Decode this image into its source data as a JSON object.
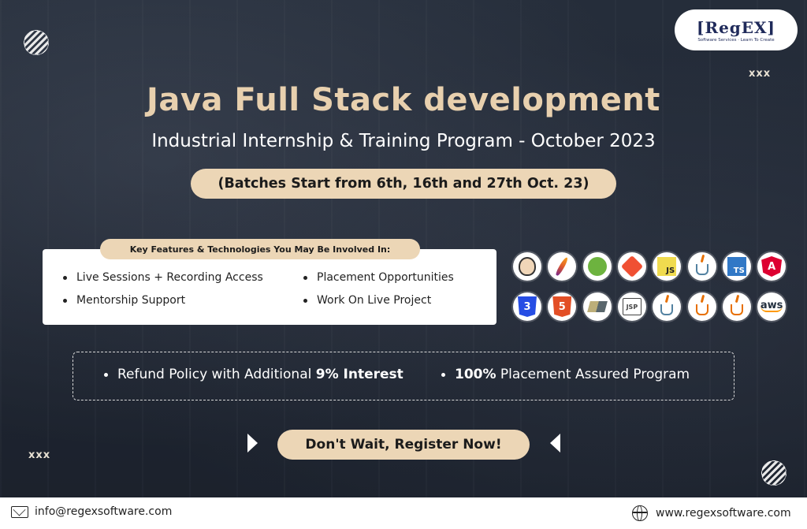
{
  "logo": {
    "text": "[RegEX]",
    "tagline": "Software Services · Learn To Create"
  },
  "decorations": {
    "xmark_top": "xxx",
    "xmark_bottom": "xxx"
  },
  "title": "Java Full Stack development",
  "subtitle": "Industrial Internship & Training Program - October 2023",
  "batches": "(Batches Start from 6th, 16th and 27th Oct. 23)",
  "features": {
    "heading": "Key Features & Technologies You May Be Involved In:",
    "items": [
      "Live Sessions + Recording Access",
      "Placement Opportunities",
      "Mentorship  Support",
      "Work On Live Project"
    ]
  },
  "technologies": [
    {
      "name": "jenkins-icon",
      "label": "",
      "color": "#d33833"
    },
    {
      "name": "maven-feather-icon",
      "label": "",
      "color": "#e05a2b"
    },
    {
      "name": "spring-icon",
      "label": "",
      "color": "#6db33f"
    },
    {
      "name": "git-icon",
      "label": "",
      "color": "#f05033"
    },
    {
      "name": "javascript-icon",
      "label": "JS",
      "color": "#f0db4f"
    },
    {
      "name": "java-icon",
      "label": "",
      "color": "#5382a1"
    },
    {
      "name": "typescript-icon",
      "label": "TS",
      "color": "#3178c6"
    },
    {
      "name": "angular-icon",
      "label": "A",
      "color": "#dd0031"
    },
    {
      "name": "css3-icon",
      "label": "3",
      "color": "#264de4"
    },
    {
      "name": "html5-icon",
      "label": "5",
      "color": "#e34f26"
    },
    {
      "name": "hibernate-icon",
      "label": "",
      "color": "#59666c"
    },
    {
      "name": "jsp-icon",
      "label": "JSP",
      "color": "#444444"
    },
    {
      "name": "java-ee-icon",
      "label": "",
      "color": "#5382a1"
    },
    {
      "name": "java-se-icon",
      "label": "",
      "color": "#e76f00"
    },
    {
      "name": "java-logo-icon",
      "label": "",
      "color": "#e76f00"
    },
    {
      "name": "aws-icon",
      "label": "aws",
      "color": "#232f3e"
    }
  ],
  "policy": {
    "refund_prefix": "Refund Policy with Additional ",
    "refund_bold": "9% Interest",
    "placement_bold": "100%",
    "placement_suffix": " Placement Assured Program"
  },
  "cta": "Don't Wait, Register  Now!",
  "footer": {
    "email": "info@regexsoftware.com",
    "website": "www.regexsoftware.com"
  }
}
